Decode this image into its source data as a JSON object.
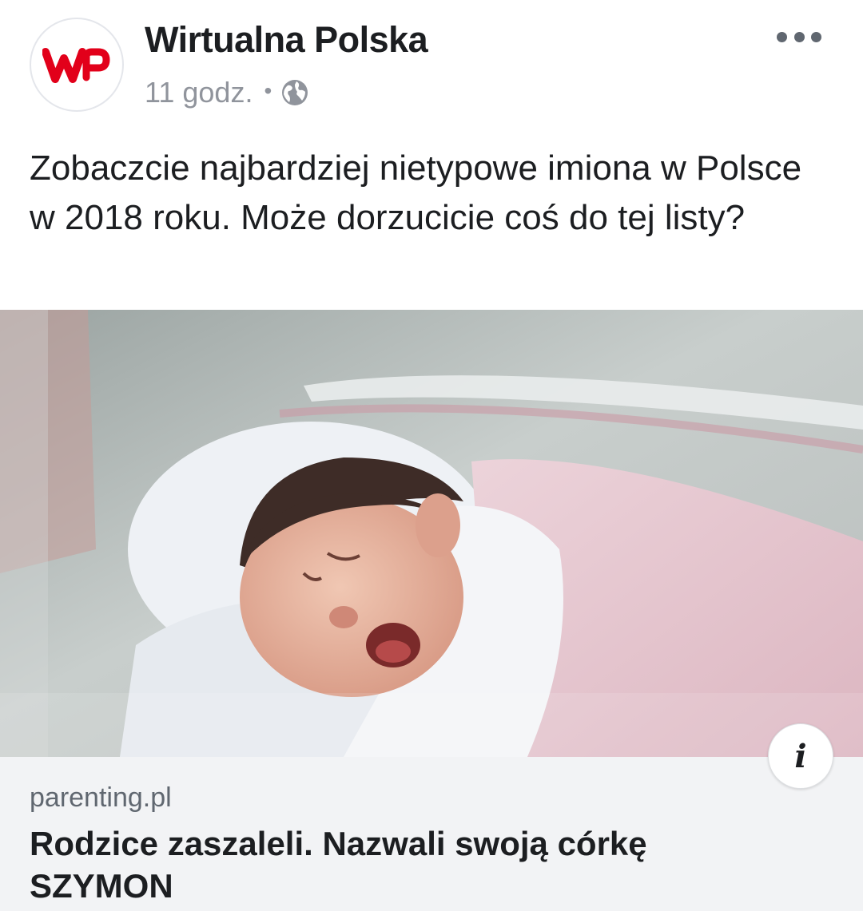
{
  "post": {
    "page_name": "Wirtualna Polska",
    "logo_text": "WP",
    "brand_color": "#e2001a",
    "timestamp": "11 godz.",
    "separator": "•",
    "audience_icon": "globe-icon",
    "more_icon": "more-options-icon",
    "caption": "Zobaczcie najbardziej nietypowe imiona w Polsce w 2018 roku. Może dorzucicie coś do tej listy?"
  },
  "photo": {
    "subject": "newborn-baby-photo"
  },
  "link": {
    "domain": "parenting.pl",
    "title": "Rodzice zaszaleli. Nazwali swoją córkę SZYMON",
    "info_icon": "info-icon",
    "info_label": "i"
  }
}
